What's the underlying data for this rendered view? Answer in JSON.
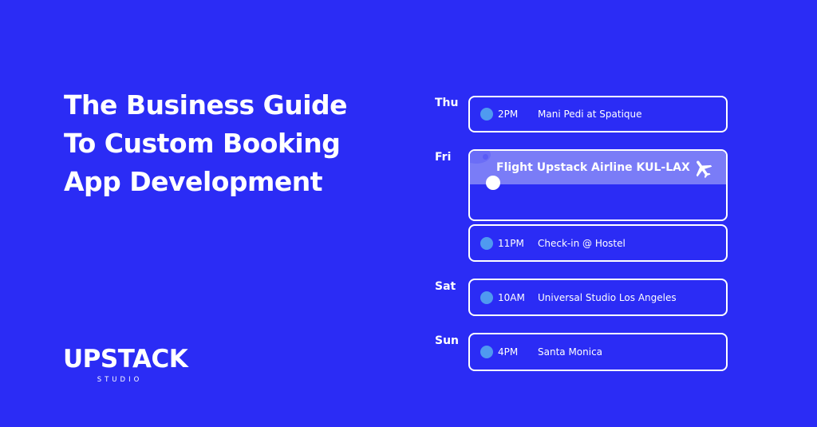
{
  "headline": [
    "The Business Guide",
    "To Custom Booking",
    "App Development"
  ],
  "logo": {
    "main": "UPSTACK",
    "sub": "STUDIO"
  },
  "accent_color": "#4f9af0",
  "background_color": "#2b2cf5",
  "schedule": {
    "days": [
      "Thu",
      "Fri",
      "Sat",
      "Sun"
    ],
    "events": [
      {
        "time": "2PM",
        "title": "Mani Pedi at Spatique"
      },
      {
        "time": "11PM",
        "title": "Check-in @ Hostel"
      },
      {
        "time": "10AM",
        "title": "Universal Studio Los Angeles"
      },
      {
        "time": "4PM",
        "title": "Santa Monica"
      }
    ],
    "flight": {
      "title": "Flight Upstack Airline KUL-LAX",
      "icon": "airplane-icon"
    }
  }
}
